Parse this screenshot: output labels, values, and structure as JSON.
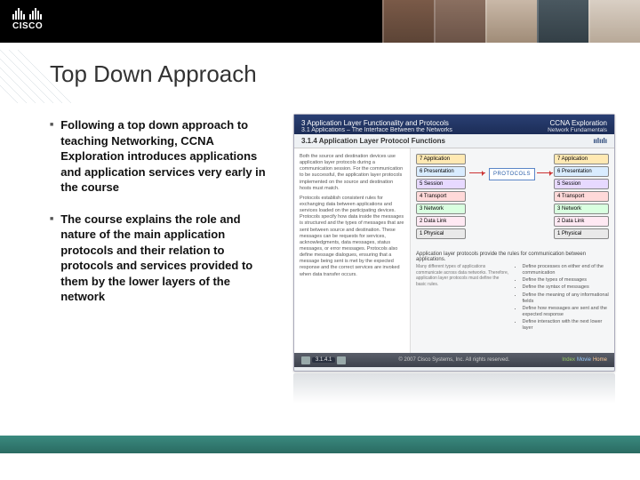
{
  "banner": {
    "logo_name": "cisco",
    "logo_text": "CISCO"
  },
  "title": "Top Down Approach",
  "bullets": [
    "Following a top down approach to teaching Networking, CCNA Exploration introduces applications and application services very early in the course",
    "The course explains the role and nature of the main application protocols and their relation to protocols and services provided to them by the lower layers of the network"
  ],
  "graphic": {
    "titlebar_left": "3 Application Layer Functionality and Protocols",
    "titlebar_sub": "3.1 Applications – The Interface Between the Networks",
    "titlebar_right_top": "CCNA Exploration",
    "titlebar_right_sub": "Network Fundamentals",
    "section_heading": "3.1.4 Application Layer Protocol Functions",
    "protocols_label": "PROTOCOLS",
    "osi_left": [
      "7 Application",
      "6 Presentation",
      "5 Session",
      "4 Transport",
      "3 Network",
      "2 Data Link",
      "1 Physical"
    ],
    "osi_right": [
      "7 Application",
      "6 Presentation",
      "5 Session",
      "4 Transport",
      "3 Network",
      "2 Data Link",
      "1 Physical"
    ],
    "caption": "Application layer protocols provide the rules for communication between applications.",
    "lower_left_lines": [
      "Both the source and destination devices use application layer protocols during a communication session. For the communication to be successful, the application layer protocols implemented on the source and destination hosts must match.",
      "Protocols establish consistent rules for exchanging data between applications and services loaded on the participating devices. Protocols specify how data inside the messages is structured and the types of messages that are sent between source and destination. These messages can be requests for services, acknowledgments, data messages, status messages, or error messages. Protocols also define message dialogues, ensuring that a message being sent is met by the expected response and the correct services are invoked when data transfer occurs."
    ],
    "lower_right_items": [
      "Define processes on either end of the communication",
      "Define the types of messages",
      "Define the syntax of messages",
      "Define the meaning of any informational fields",
      "Define how messages are sent and the expected response",
      "Define interaction with the next lower layer"
    ],
    "page_indicator": "3.1.4.1",
    "footer_legal": "© 2007 Cisco Systems, Inc. All rights reserved.",
    "footer_links": [
      "Index",
      "Movie",
      "Home"
    ]
  }
}
